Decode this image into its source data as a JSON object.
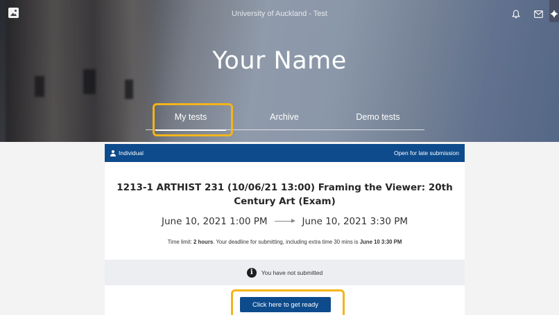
{
  "header": {
    "site_title": "University of Auckland - Test",
    "user_name": "Your Name",
    "icons": [
      "app-logo-icon",
      "bell-icon",
      "mail-icon",
      "gear-icon"
    ]
  },
  "tabs": [
    {
      "label": "My tests",
      "active": true
    },
    {
      "label": "Archive",
      "active": false
    },
    {
      "label": "Demo tests",
      "active": false
    }
  ],
  "test_card": {
    "type_label": "Individual",
    "status_label": "Open for late submission",
    "title": "1213-1 ARTHIST 231 (10/06/21 13:00) Framing the Viewer: 20th Century Art (Exam)",
    "start": "June 10, 2021 1:00 PM",
    "end": "June 10, 2021 3:30 PM",
    "time_limit_prefix": "Time limit: ",
    "time_limit_value": "2 hours",
    "deadline_text": ". Your deadline for submitting, including extra time 30 mins is ",
    "deadline_value": "June 10 3:30 PM",
    "submission_status": "You have not submitted",
    "ready_button": "Click here to get ready"
  },
  "colors": {
    "primary": "#0d4b8c",
    "highlight": "#f4b41a",
    "status_bg": "#edeef2"
  }
}
